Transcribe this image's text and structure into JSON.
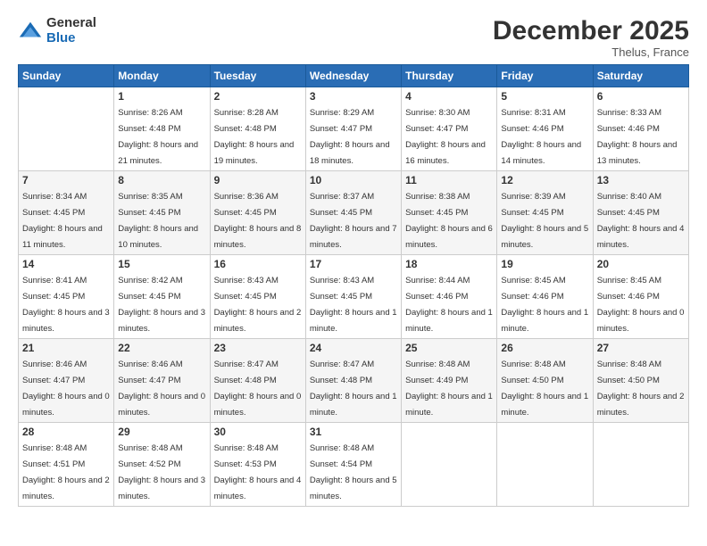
{
  "logo": {
    "general": "General",
    "blue": "Blue"
  },
  "title": "December 2025",
  "subtitle": "Thelus, France",
  "header_days": [
    "Sunday",
    "Monday",
    "Tuesday",
    "Wednesday",
    "Thursday",
    "Friday",
    "Saturday"
  ],
  "weeks": [
    [
      {
        "day": "",
        "sunrise": "",
        "sunset": "",
        "daylight": ""
      },
      {
        "day": "1",
        "sunrise": "Sunrise: 8:26 AM",
        "sunset": "Sunset: 4:48 PM",
        "daylight": "Daylight: 8 hours and 21 minutes."
      },
      {
        "day": "2",
        "sunrise": "Sunrise: 8:28 AM",
        "sunset": "Sunset: 4:48 PM",
        "daylight": "Daylight: 8 hours and 19 minutes."
      },
      {
        "day": "3",
        "sunrise": "Sunrise: 8:29 AM",
        "sunset": "Sunset: 4:47 PM",
        "daylight": "Daylight: 8 hours and 18 minutes."
      },
      {
        "day": "4",
        "sunrise": "Sunrise: 8:30 AM",
        "sunset": "Sunset: 4:47 PM",
        "daylight": "Daylight: 8 hours and 16 minutes."
      },
      {
        "day": "5",
        "sunrise": "Sunrise: 8:31 AM",
        "sunset": "Sunset: 4:46 PM",
        "daylight": "Daylight: 8 hours and 14 minutes."
      },
      {
        "day": "6",
        "sunrise": "Sunrise: 8:33 AM",
        "sunset": "Sunset: 4:46 PM",
        "daylight": "Daylight: 8 hours and 13 minutes."
      }
    ],
    [
      {
        "day": "7",
        "sunrise": "Sunrise: 8:34 AM",
        "sunset": "Sunset: 4:45 PM",
        "daylight": "Daylight: 8 hours and 11 minutes."
      },
      {
        "day": "8",
        "sunrise": "Sunrise: 8:35 AM",
        "sunset": "Sunset: 4:45 PM",
        "daylight": "Daylight: 8 hours and 10 minutes."
      },
      {
        "day": "9",
        "sunrise": "Sunrise: 8:36 AM",
        "sunset": "Sunset: 4:45 PM",
        "daylight": "Daylight: 8 hours and 8 minutes."
      },
      {
        "day": "10",
        "sunrise": "Sunrise: 8:37 AM",
        "sunset": "Sunset: 4:45 PM",
        "daylight": "Daylight: 8 hours and 7 minutes."
      },
      {
        "day": "11",
        "sunrise": "Sunrise: 8:38 AM",
        "sunset": "Sunset: 4:45 PM",
        "daylight": "Daylight: 8 hours and 6 minutes."
      },
      {
        "day": "12",
        "sunrise": "Sunrise: 8:39 AM",
        "sunset": "Sunset: 4:45 PM",
        "daylight": "Daylight: 8 hours and 5 minutes."
      },
      {
        "day": "13",
        "sunrise": "Sunrise: 8:40 AM",
        "sunset": "Sunset: 4:45 PM",
        "daylight": "Daylight: 8 hours and 4 minutes."
      }
    ],
    [
      {
        "day": "14",
        "sunrise": "Sunrise: 8:41 AM",
        "sunset": "Sunset: 4:45 PM",
        "daylight": "Daylight: 8 hours and 3 minutes."
      },
      {
        "day": "15",
        "sunrise": "Sunrise: 8:42 AM",
        "sunset": "Sunset: 4:45 PM",
        "daylight": "Daylight: 8 hours and 3 minutes."
      },
      {
        "day": "16",
        "sunrise": "Sunrise: 8:43 AM",
        "sunset": "Sunset: 4:45 PM",
        "daylight": "Daylight: 8 hours and 2 minutes."
      },
      {
        "day": "17",
        "sunrise": "Sunrise: 8:43 AM",
        "sunset": "Sunset: 4:45 PM",
        "daylight": "Daylight: 8 hours and 1 minute."
      },
      {
        "day": "18",
        "sunrise": "Sunrise: 8:44 AM",
        "sunset": "Sunset: 4:46 PM",
        "daylight": "Daylight: 8 hours and 1 minute."
      },
      {
        "day": "19",
        "sunrise": "Sunrise: 8:45 AM",
        "sunset": "Sunset: 4:46 PM",
        "daylight": "Daylight: 8 hours and 1 minute."
      },
      {
        "day": "20",
        "sunrise": "Sunrise: 8:45 AM",
        "sunset": "Sunset: 4:46 PM",
        "daylight": "Daylight: 8 hours and 0 minutes."
      }
    ],
    [
      {
        "day": "21",
        "sunrise": "Sunrise: 8:46 AM",
        "sunset": "Sunset: 4:47 PM",
        "daylight": "Daylight: 8 hours and 0 minutes."
      },
      {
        "day": "22",
        "sunrise": "Sunrise: 8:46 AM",
        "sunset": "Sunset: 4:47 PM",
        "daylight": "Daylight: 8 hours and 0 minutes."
      },
      {
        "day": "23",
        "sunrise": "Sunrise: 8:47 AM",
        "sunset": "Sunset: 4:48 PM",
        "daylight": "Daylight: 8 hours and 0 minutes."
      },
      {
        "day": "24",
        "sunrise": "Sunrise: 8:47 AM",
        "sunset": "Sunset: 4:48 PM",
        "daylight": "Daylight: 8 hours and 1 minute."
      },
      {
        "day": "25",
        "sunrise": "Sunrise: 8:48 AM",
        "sunset": "Sunset: 4:49 PM",
        "daylight": "Daylight: 8 hours and 1 minute."
      },
      {
        "day": "26",
        "sunrise": "Sunrise: 8:48 AM",
        "sunset": "Sunset: 4:50 PM",
        "daylight": "Daylight: 8 hours and 1 minute."
      },
      {
        "day": "27",
        "sunrise": "Sunrise: 8:48 AM",
        "sunset": "Sunset: 4:50 PM",
        "daylight": "Daylight: 8 hours and 2 minutes."
      }
    ],
    [
      {
        "day": "28",
        "sunrise": "Sunrise: 8:48 AM",
        "sunset": "Sunset: 4:51 PM",
        "daylight": "Daylight: 8 hours and 2 minutes."
      },
      {
        "day": "29",
        "sunrise": "Sunrise: 8:48 AM",
        "sunset": "Sunset: 4:52 PM",
        "daylight": "Daylight: 8 hours and 3 minutes."
      },
      {
        "day": "30",
        "sunrise": "Sunrise: 8:48 AM",
        "sunset": "Sunset: 4:53 PM",
        "daylight": "Daylight: 8 hours and 4 minutes."
      },
      {
        "day": "31",
        "sunrise": "Sunrise: 8:48 AM",
        "sunset": "Sunset: 4:54 PM",
        "daylight": "Daylight: 8 hours and 5 minutes."
      },
      {
        "day": "",
        "sunrise": "",
        "sunset": "",
        "daylight": ""
      },
      {
        "day": "",
        "sunrise": "",
        "sunset": "",
        "daylight": ""
      },
      {
        "day": "",
        "sunrise": "",
        "sunset": "",
        "daylight": ""
      }
    ]
  ]
}
